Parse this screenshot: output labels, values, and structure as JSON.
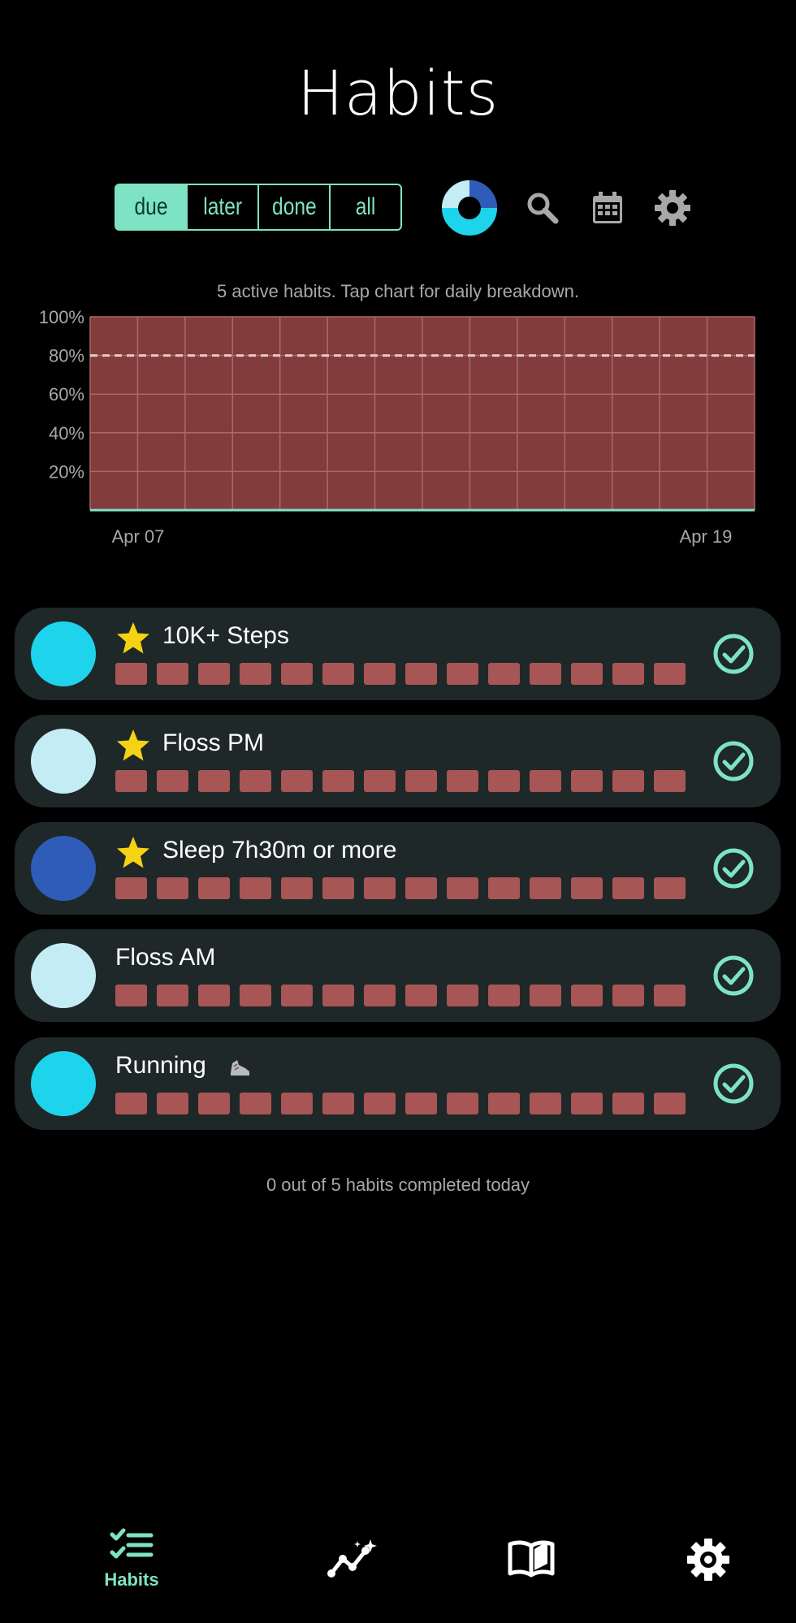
{
  "header": {
    "title": "Habits"
  },
  "filter": {
    "tabs": [
      {
        "label": "due",
        "active": true
      },
      {
        "label": "later",
        "active": false
      },
      {
        "label": "done",
        "active": false
      },
      {
        "label": "all",
        "active": false
      }
    ]
  },
  "toolbar": {
    "icons": [
      "donut-chart-icon",
      "search-icon",
      "calendar-icon",
      "gear-icon"
    ]
  },
  "subtitle": "5 active habits. Tap chart for daily breakdown.",
  "chart_data": {
    "type": "area",
    "y_tick_labels": [
      "100%",
      "80%",
      "60%",
      "40%",
      "20%"
    ],
    "x_tick_labels": [
      "Apr 07",
      "Apr 19"
    ],
    "ylim": [
      0,
      100
    ],
    "target_line": 80,
    "values": [
      0,
      0,
      0,
      0,
      0,
      0,
      0,
      0,
      0,
      0,
      0,
      0,
      0,
      0
    ],
    "grid": true,
    "colors": {
      "background": "#823c3c",
      "grid": "#a86a6a",
      "target": "#e8c8c8",
      "line": "#7de3c4"
    }
  },
  "habits": [
    {
      "name": "10K+ Steps",
      "starred": true,
      "color": "#1ed4ec"
    },
    {
      "name": "Floss PM",
      "starred": true,
      "color": "#c4ecf4"
    },
    {
      "name": "Sleep 7h30m or more",
      "starred": true,
      "color": "#2e5cb8"
    },
    {
      "name": "Floss AM",
      "starred": false,
      "color": "#c4ecf4"
    },
    {
      "name": "Running",
      "starred": false,
      "color": "#1ed4ec",
      "emoji": "shoe-icon"
    }
  ],
  "summary": "0 out of 5 habits completed today",
  "bottom_nav": [
    {
      "label": "Habits",
      "icon": "checklist-icon",
      "active": true
    },
    {
      "label": "",
      "icon": "stats-sparkle-icon",
      "active": false
    },
    {
      "label": "",
      "icon": "book-icon",
      "active": false
    },
    {
      "label": "",
      "icon": "gear-icon",
      "active": false
    }
  ],
  "colors": {
    "accent": "#7de3c4",
    "card": "#1e2828",
    "missed": "#a85555",
    "star": "#f5d312"
  }
}
